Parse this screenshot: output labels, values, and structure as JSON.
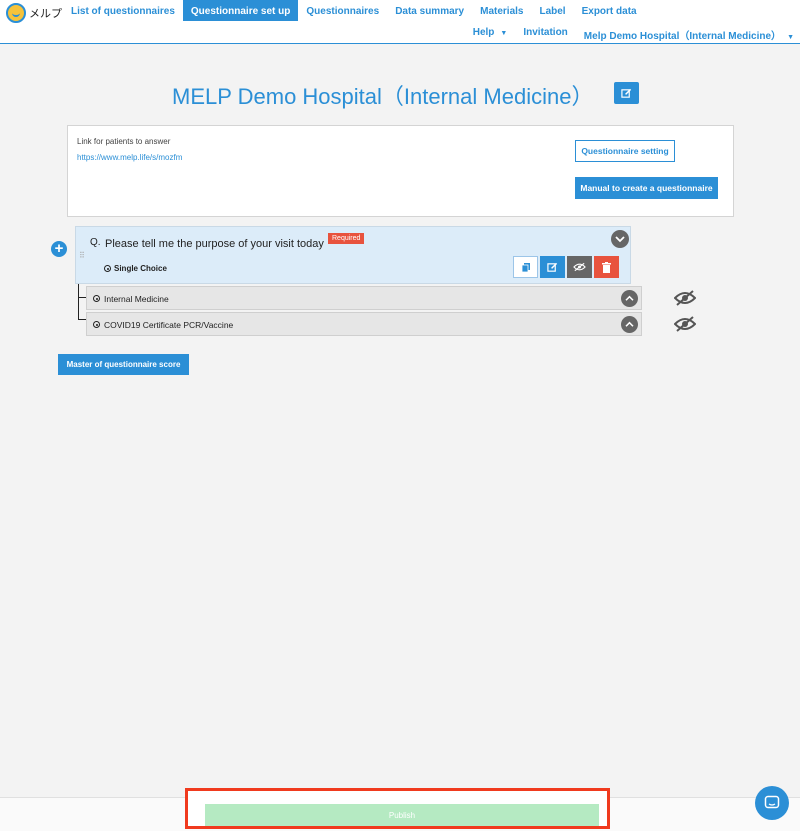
{
  "app": {
    "logo_text": "メルプ"
  },
  "nav": {
    "tabs": [
      {
        "label": "List of questionnaires"
      },
      {
        "label": "Questionnaire set up",
        "active": true
      },
      {
        "label": "Questionnaires"
      },
      {
        "label": "Data summary"
      },
      {
        "label": "Materials"
      },
      {
        "label": "Label"
      },
      {
        "label": "Export data"
      }
    ],
    "secondary": {
      "help": "Help",
      "invitation": "Invitation",
      "account": "Melp Demo Hospital（Internal Medicine）"
    }
  },
  "page": {
    "title": "MELP Demo Hospital（Internal Medicine）"
  },
  "link_box": {
    "label": "Link for patients to answer",
    "url": "https://www.melp.life/s/mozfm",
    "setting_button": "Questionnaire setting",
    "manual_button": "Manual to create a questionnaire"
  },
  "question": {
    "prefix": "Q.",
    "text": "Please tell me the purpose of your visit today",
    "required_badge": "Required",
    "type": "Single Choice",
    "options": [
      {
        "label": "Internal Medicine"
      },
      {
        "label": "COVID19 Certificate PCR/Vaccine"
      }
    ]
  },
  "master_button": "Master of questionnaire score",
  "footer": {
    "publish_button": "Publish"
  },
  "colors": {
    "accent": "#2b8fd6",
    "danger": "#e8533e",
    "publish_disabled": "#b5eac2",
    "highlight": "#f03a1e"
  }
}
